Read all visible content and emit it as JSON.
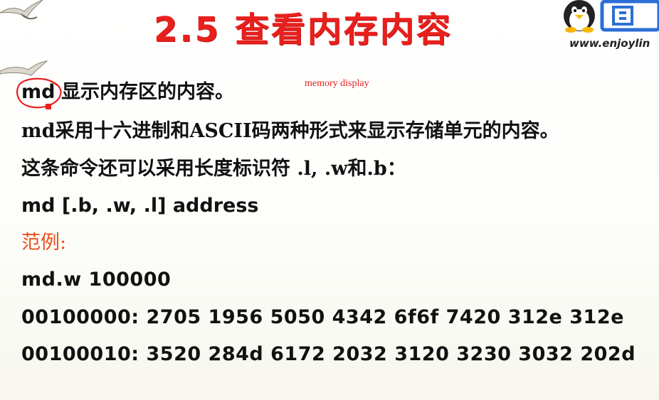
{
  "slide": {
    "title": "2.5 查看内存内容",
    "url": "www.enjoylin",
    "annotation": "memory display",
    "line1_cmd": "md",
    "line1_rest": "显示内存区的内容。",
    "line2": "md采用十六进制和ASCII码两种形式来显示存储单元的内容。",
    "line3": "这条命令还可以采用长度标识符 .l, .w和.b：",
    "line4": "md [.b, .w, .l] address",
    "example_label": "范例:",
    "example_cmd": "md.w 100000",
    "dump1": "00100000: 2705 1956 5050 4342 6f6f 7420 312e 312e",
    "dump2": "00100010: 3520 284d 6172 2032 3120 3230 3032 202d"
  },
  "colors": {
    "title": "#e8201c",
    "example_label": "#e8501c",
    "annotation": "#e8201c",
    "logo_blue": "#2b6fd6"
  },
  "icons": [
    "seagull-icon",
    "penguin-icon"
  ]
}
